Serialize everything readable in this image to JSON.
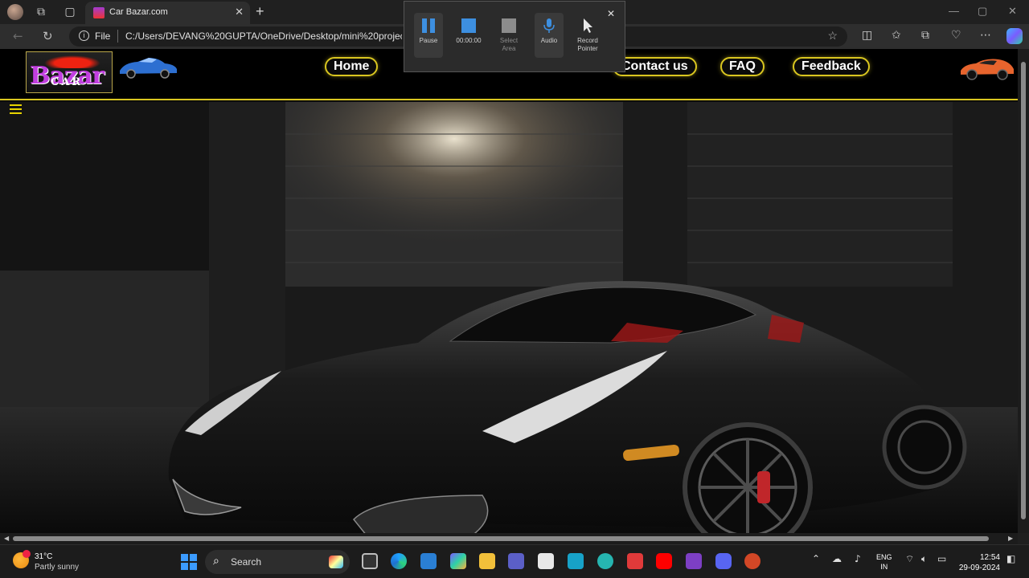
{
  "browser": {
    "tab_title": "Car Bazar.com",
    "address_scheme": "File",
    "address_url": "C:/Users/DEVANG%20GUPTA/OneDrive/Desktop/mini%20project/c"
  },
  "site": {
    "logo_text": "Bazar",
    "logo_sub": "CAR",
    "nav": [
      "Home",
      "Contact us",
      "FAQ",
      "Feedback"
    ]
  },
  "recorder": {
    "pause_label": "Pause",
    "timer": "00:00:00",
    "select_area_label": "Select Area",
    "audio_label": "Audio",
    "record_pointer_label": "Record Pointer"
  },
  "taskbar": {
    "temperature": "31°C",
    "weather": "Partly sunny",
    "search_label": "Search",
    "lang_top": "ENG",
    "lang_bottom": "IN",
    "time": "12:54",
    "date": "29-09-2024"
  },
  "colors": {
    "accent": "#d9c620",
    "logo_purple": "#c23ee0",
    "browser_bg": "#202020"
  }
}
